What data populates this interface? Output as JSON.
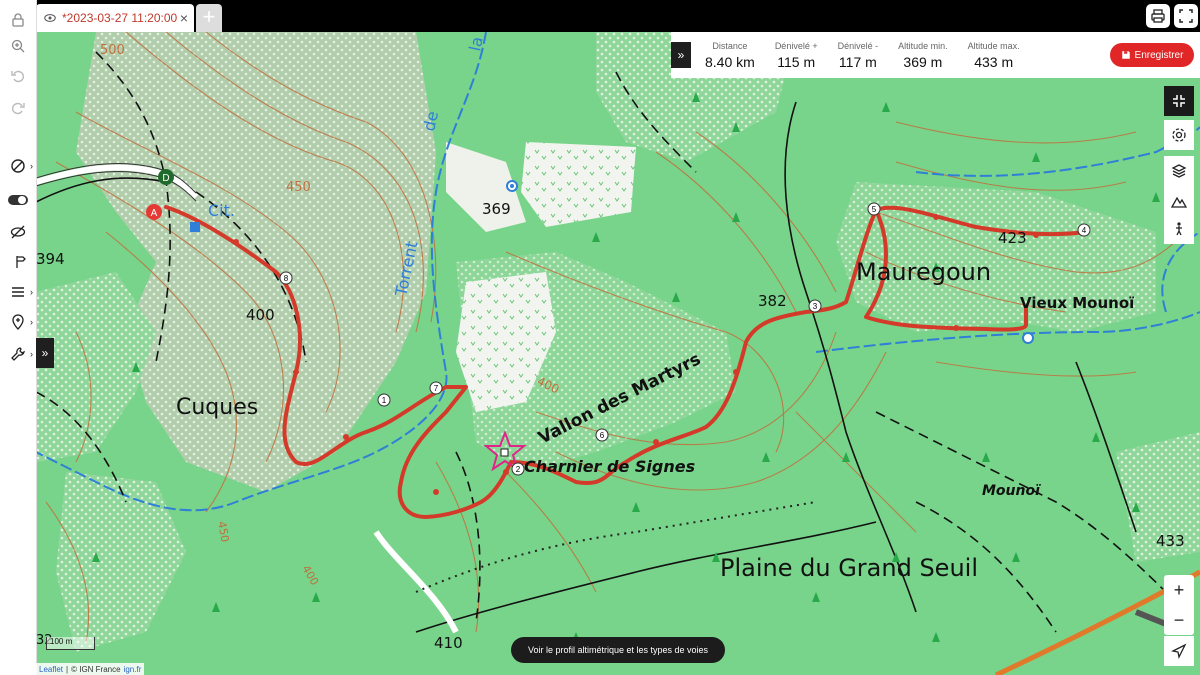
{
  "tab": {
    "title": "*2023-03-27 11:20:00",
    "close_glyph": "×",
    "add_glyph": "+"
  },
  "stats": [
    {
      "label": "Distance",
      "value": "8.40 km"
    },
    {
      "label": "Dénivelé +",
      "value": "115 m"
    },
    {
      "label": "Dénivelé -",
      "value": "117 m"
    },
    {
      "label": "Altitude min.",
      "value": "369 m"
    },
    {
      "label": "Altitude max.",
      "value": "433 m"
    }
  ],
  "save_button": {
    "label": "Enregistrer"
  },
  "profile_button": {
    "label": "Voir le profil altimétrique et les types de voies"
  },
  "attribution": {
    "leaflet": "Leaflet",
    "sep": "|",
    "copyright": "© IGN France",
    "ign": "ign.fr"
  },
  "scale_label": "100 m",
  "map_labels": {
    "cuques": "Cuques",
    "mauregoun": "Mauregoun",
    "vieux_mounoi": "Vieux Mounoï",
    "vallon": "Vallon des Martyrs",
    "charnier": "Charnier de Signes",
    "plaine": "Plaine du Grand Seuil",
    "mounoi": "Mounoï",
    "torrent": "Torrent",
    "de": "de",
    "la": "la",
    "cit": "Cit.",
    "alt_500": "500",
    "alt_450": "450",
    "alt_400_w": "400",
    "alt_400_c": "400",
    "alt_394": "394",
    "alt_369": "369",
    "alt_382": "382",
    "alt_423": "423",
    "alt_433": "433",
    "alt_410": "410",
    "alt_32": "32",
    "alt_450b": "450",
    "alt_400b": "400"
  },
  "markers": {
    "start": "A",
    "end": "D",
    "waypoints": [
      "1",
      "2",
      "3",
      "4",
      "5",
      "6",
      "7",
      "8"
    ]
  },
  "colors": {
    "map_green": "#78d48a",
    "route": "#d43a2a",
    "contour": "#c0703e",
    "water": "#2f7fd8",
    "save": "#e02626",
    "tab_title": "#c0392b"
  },
  "icons": [
    "lock-icon",
    "zoom-plus-icon",
    "undo-icon",
    "redo-icon",
    "route-icon",
    "toggle-icon",
    "eye-off-icon",
    "signpost-icon",
    "menu-icon",
    "pin-icon",
    "wrench-icon",
    "print-icon",
    "fullscreen-icon",
    "collapse-icon",
    "settings-icon",
    "layers-icon",
    "elevation-icon",
    "hiker-icon",
    "gps-icon",
    "eye-icon",
    "save-icon"
  ]
}
